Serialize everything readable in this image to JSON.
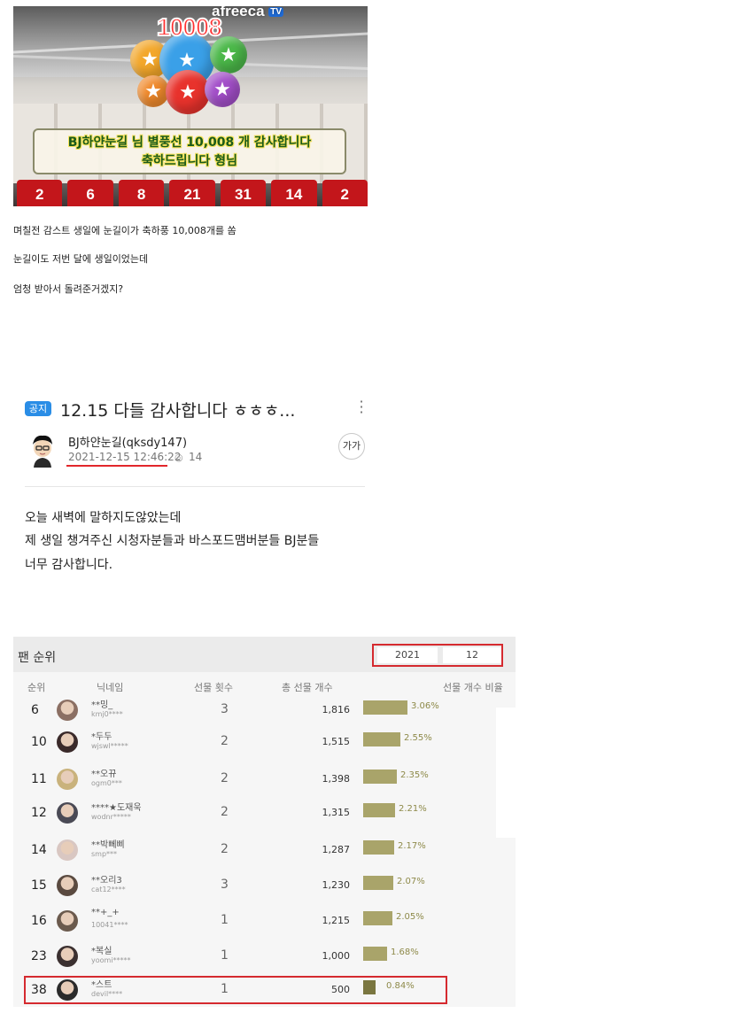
{
  "broadcast_image": {
    "count": "10008",
    "logo": "afreeca",
    "logo_badge": "TV",
    "banner_line1": "BJ하얀눈길 님 별풍선 10,008 개 감사합니다",
    "banner_line2": "축하드립니다 형님",
    "shirts": [
      "2",
      "6",
      "8",
      "21",
      "31",
      "14",
      "2"
    ]
  },
  "post": {
    "lines": [
      "며칠전 감스트 생일에 눈길이가 축하풍 10,008개를 쏨",
      "눈길이도 저번 달에 생일이었는데",
      "엄청 받아서 돌려준거겠지?"
    ]
  },
  "notice": {
    "badge": "공지",
    "title": "12.15 다들 감사합니다 ㅎㅎㅎ...",
    "author": "BJ하얀눈길(qksdy147)",
    "date": "2021-12-15 12:46:22",
    "views": "14",
    "font_button": "가가",
    "body": [
      "오늘 새벽에 말하지도않았는데",
      "제 생일 챙겨주신 시청자분들과 바스포드맴버분들 BJ분들",
      "너무 감사합니다."
    ]
  },
  "fan_ranking": {
    "title": "팬 순위",
    "year": "2021",
    "month": "12",
    "columns": {
      "rank": "순위",
      "nickname": "닉네임",
      "gift_count": "선물 횟수",
      "total_gifts": "총 선물 개수",
      "ratio": "선물 개수 비율"
    },
    "rows": [
      {
        "rank": "6",
        "nick": "**밍_",
        "id": "kmj0****",
        "gifts": "3",
        "total": "1,816",
        "pct": "3.06%",
        "ratio": 3.06,
        "avatar_color": "#8b6f63"
      },
      {
        "rank": "10",
        "nick": "*두두",
        "id": "wjswl*****",
        "gifts": "2",
        "total": "1,515",
        "pct": "2.55%",
        "ratio": 2.55,
        "avatar_color": "#3a2a2a"
      },
      {
        "rank": "11",
        "nick": "**오뀨",
        "id": "ogm0***",
        "gifts": "2",
        "total": "1,398",
        "pct": "2.35%",
        "ratio": 2.35,
        "avatar_color": "#c9b27c"
      },
      {
        "rank": "12",
        "nick": "****★도재욱",
        "id": "wodnr*****",
        "gifts": "2",
        "total": "1,315",
        "pct": "2.21%",
        "ratio": 2.21,
        "avatar_color": "#4a4a55"
      },
      {
        "rank": "14",
        "nick": "**박뻬삐",
        "id": "smp***",
        "gifts": "2",
        "total": "1,287",
        "pct": "2.17%",
        "ratio": 2.17,
        "avatar_color": "#d9c7c2"
      },
      {
        "rank": "15",
        "nick": "**오리3",
        "id": "cat12****",
        "gifts": "3",
        "total": "1,230",
        "pct": "2.07%",
        "ratio": 2.07,
        "avatar_color": "#5a4a40"
      },
      {
        "rank": "16",
        "nick": "**+_+",
        "id": "10041****",
        "gifts": "1",
        "total": "1,215",
        "pct": "2.05%",
        "ratio": 2.05,
        "avatar_color": "#6b5a4d"
      },
      {
        "rank": "23",
        "nick": "*복실",
        "id": "yoomi*****",
        "gifts": "1",
        "total": "1,000",
        "pct": "1.68%",
        "ratio": 1.68,
        "avatar_color": "#3b3030"
      },
      {
        "rank": "38",
        "nick": "*스트",
        "id": "devil****",
        "gifts": "1",
        "total": "500",
        "pct": "0.84%",
        "ratio": 0.84,
        "avatar_color": "#2a2a2a"
      }
    ],
    "bar_color": "#a9a46a",
    "highlight_color": "#d52a2f"
  }
}
